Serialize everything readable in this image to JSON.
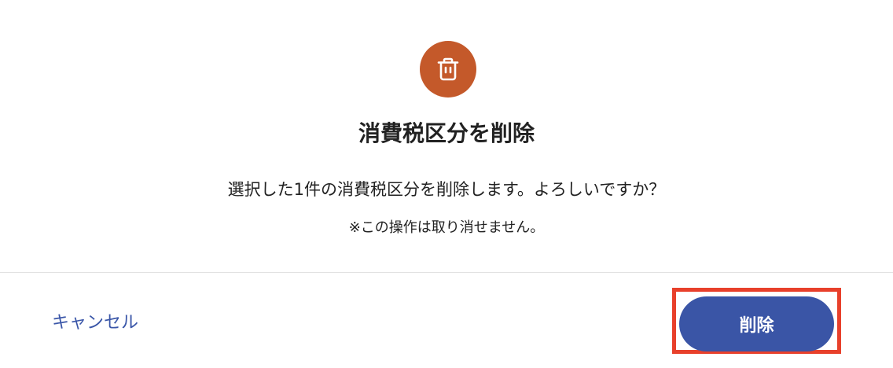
{
  "dialog": {
    "icon": "trash-icon",
    "icon_bg_color": "#c4592a",
    "title": "消費税区分を削除",
    "message": "選択した1件の消費税区分を削除します。よろしいですか？",
    "note": "※この操作は取り消せません。"
  },
  "footer": {
    "cancel_label": "キャンセル",
    "delete_label": "削除",
    "accent_color": "#3a55a6",
    "highlight_color": "#e8402b"
  }
}
